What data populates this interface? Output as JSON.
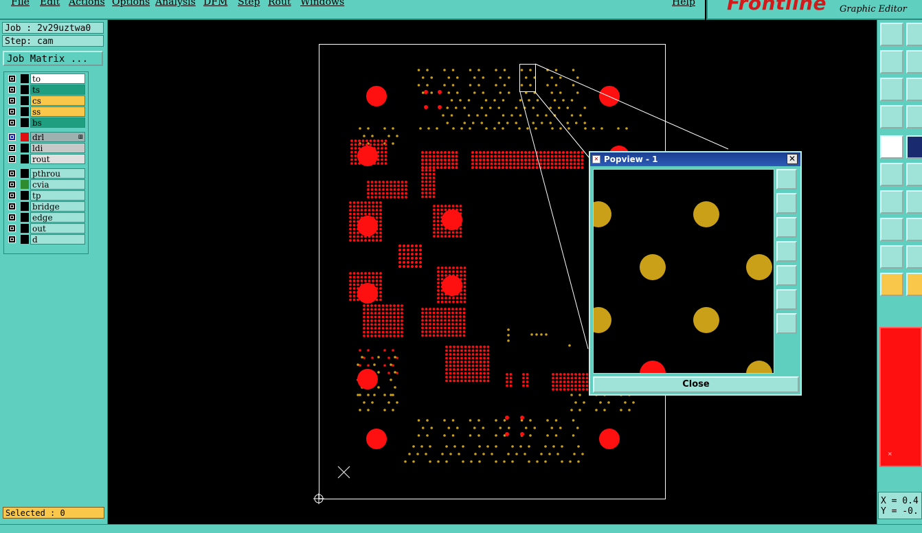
{
  "menu": {
    "items": [
      "File",
      "Edit",
      "Actions",
      "Options",
      "Analysis",
      "DFM",
      "Step",
      "Rout",
      "Windows"
    ],
    "help": "Help"
  },
  "brand": {
    "logo": "Frontline",
    "subtitle": "Graphic Editor"
  },
  "job": {
    "label": "Job : 2v29uztwa0",
    "step": "Step: cam",
    "matrix_button": "Job Matrix ..."
  },
  "layers": [
    {
      "name": "to",
      "swatch": "#000000",
      "bg": "#ffffff"
    },
    {
      "name": "ts",
      "swatch": "#000000",
      "bg": "#1f9f80"
    },
    {
      "name": "cs",
      "swatch": "#000000",
      "bg": "#f9c84a"
    },
    {
      "name": "ss",
      "swatch": "#000000",
      "bg": "#f9c84a"
    },
    {
      "name": "bs",
      "swatch": "#000000",
      "bg": "#1f9f80"
    },
    {
      "name": "drl",
      "swatch": "#e01010",
      "bg": "#9fb0b0",
      "marker": "⊞"
    },
    {
      "name": "ldi",
      "swatch": "#000000",
      "bg": "#c8c8c8"
    },
    {
      "name": "rout",
      "swatch": "#000000",
      "bg": "#e0e0e0"
    },
    {
      "name": "pthrou",
      "swatch": "#000000",
      "bg": "#9fe3d8"
    },
    {
      "name": "cvia",
      "swatch": "#2e8b2e",
      "bg": "#9fe3d8"
    },
    {
      "name": "tp",
      "swatch": "#000000",
      "bg": "#9fe3d8"
    },
    {
      "name": "bridge",
      "swatch": "#000000",
      "bg": "#9fe3d8"
    },
    {
      "name": "edge",
      "swatch": "#000000",
      "bg": "#9fe3d8"
    },
    {
      "name": "out",
      "swatch": "#000000",
      "bg": "#9fe3d8"
    },
    {
      "name": "d",
      "swatch": "#000000",
      "bg": "#9fe3d8"
    }
  ],
  "status": {
    "selected": "Selected : 0"
  },
  "coords": {
    "x": "X = 0.4",
    "y": "Y = -0."
  },
  "popview": {
    "title": "Popview - 1",
    "close_label": "Close",
    "close_x": "✕"
  },
  "colors": {
    "pad_red": "#ff1010",
    "pad_gold": "#c9a018",
    "panel": "#5fcfbf"
  }
}
